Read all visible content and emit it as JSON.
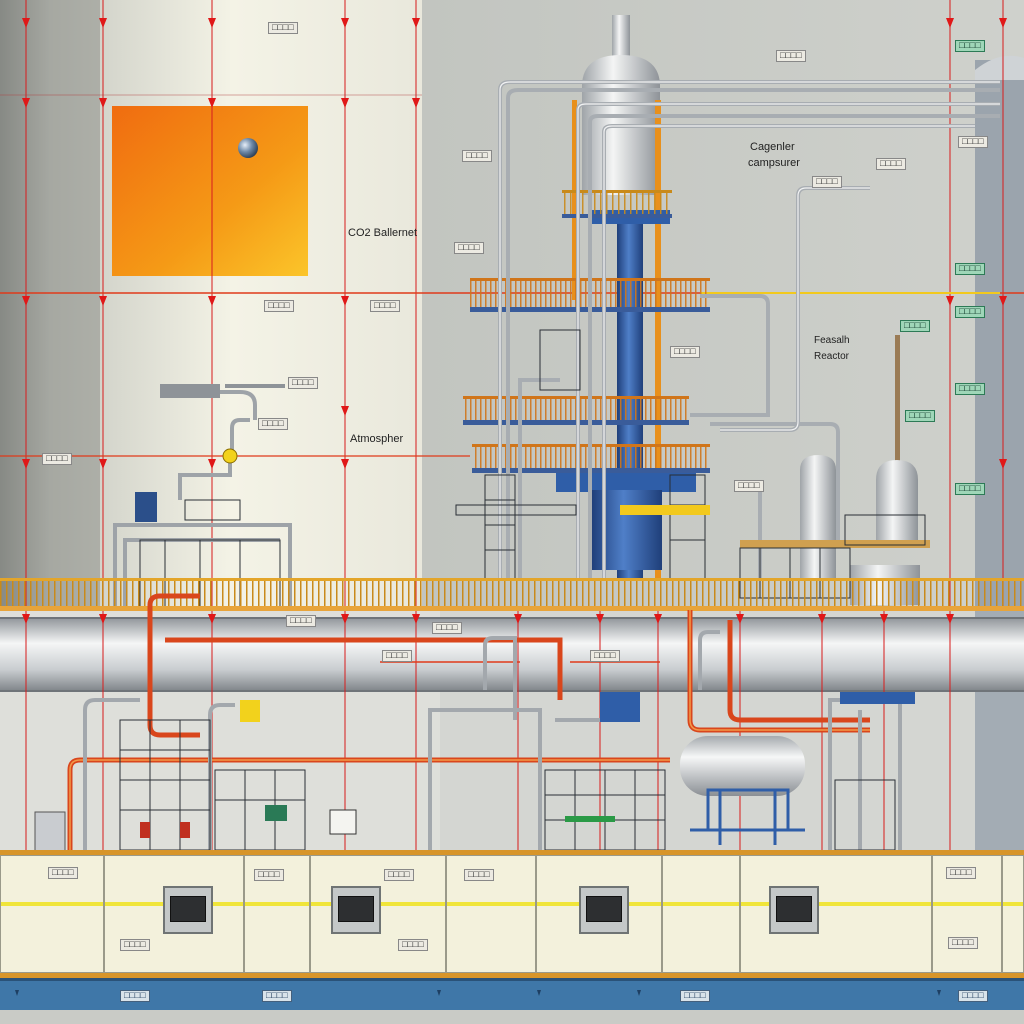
{
  "labels": {
    "co2_balance": "CO2 Ballernet",
    "atmosphere": "Atmospher",
    "capsule_top": "Cagenler",
    "capsule_bottom": "campsurer",
    "reactor_top": "Feasalh",
    "reactor_bottom": "Reactor"
  },
  "tags": {
    "t1": "□□□□",
    "t2": "□□□□",
    "t3": "□□□□",
    "t4": "□□□□",
    "t5": "□□□□",
    "t6": "□□□□",
    "t7": "□□□□",
    "t8": "□□□□",
    "t9": "□□□□",
    "t10": "□□□□",
    "t11": "□□□□",
    "t12": "□□□□",
    "t13": "□□□□",
    "t14": "□□□□",
    "t15": "□□□□",
    "t16": "□□□□",
    "t17": "□□□□",
    "t18": "□□□□",
    "t19": "□□□□",
    "t20": "□□□□",
    "t21": "□□□□",
    "t22": "□□□□",
    "t23": "□□□□",
    "t24": "□□□□",
    "t25": "□□□□",
    "t26": "□□□□",
    "t27": "□□□□",
    "t28": "□□□□",
    "t29": "□□□□",
    "t30": "□□□□",
    "t31": "□□□□",
    "t32": "□□□□",
    "t33": "□□□□"
  },
  "colors": {
    "accent_orange": "#f28a16",
    "accent_yellow": "#f5c200",
    "gridline_red": "#d82020",
    "pipe_silver": "#b8bdc2",
    "structure_blue": "#2f5ea8",
    "tag_green": "#9fd6b8"
  }
}
